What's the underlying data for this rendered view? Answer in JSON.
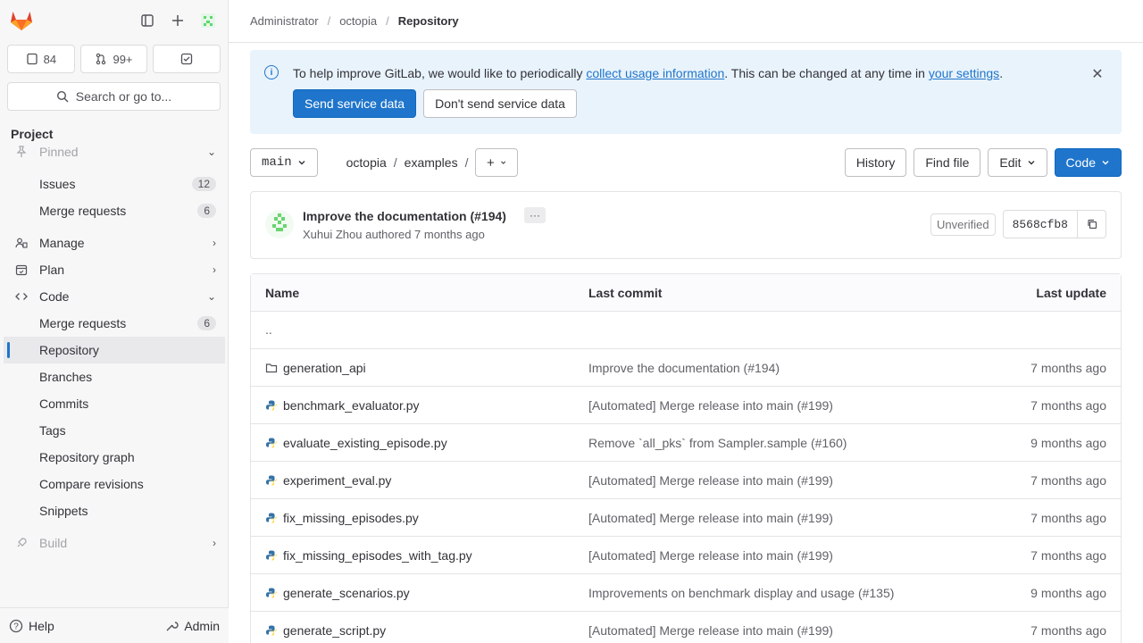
{
  "sidebar": {
    "counts": [
      {
        "icon": "issue-icon",
        "value": "84"
      },
      {
        "icon": "merge-request-icon",
        "value": "99+"
      },
      {
        "icon": "todo-icon",
        "value": ""
      }
    ],
    "search_label": "Search or go to...",
    "section_title": "Project",
    "nav": [
      {
        "label": "Pinned",
        "icon": "pin-icon",
        "badge": "",
        "chevron": "⌄",
        "active": false,
        "faded": true
      },
      {
        "label": "Issues",
        "icon": "",
        "badge": "12",
        "chevron": "",
        "active": false,
        "faded": false
      },
      {
        "label": "Merge requests",
        "icon": "",
        "badge": "6",
        "chevron": "",
        "active": false,
        "faded": false
      },
      {
        "label": "Manage",
        "icon": "users-icon",
        "badge": "",
        "chevron": "›",
        "active": false,
        "faded": false
      },
      {
        "label": "Plan",
        "icon": "calendar-icon",
        "badge": "",
        "chevron": "›",
        "active": false,
        "faded": false
      },
      {
        "label": "Code",
        "icon": "code-icon",
        "badge": "",
        "chevron": "⌄",
        "active": false,
        "faded": false
      },
      {
        "label": "Merge requests",
        "icon": "",
        "badge": "6",
        "chevron": "",
        "active": false,
        "faded": false
      },
      {
        "label": "Repository",
        "icon": "",
        "badge": "",
        "chevron": "",
        "active": true,
        "faded": false
      },
      {
        "label": "Branches",
        "icon": "",
        "badge": "",
        "chevron": "",
        "active": false,
        "faded": false
      },
      {
        "label": "Commits",
        "icon": "",
        "badge": "",
        "chevron": "",
        "active": false,
        "faded": false
      },
      {
        "label": "Tags",
        "icon": "",
        "badge": "",
        "chevron": "",
        "active": false,
        "faded": false
      },
      {
        "label": "Repository graph",
        "icon": "",
        "badge": "",
        "chevron": "",
        "active": false,
        "faded": false
      },
      {
        "label": "Compare revisions",
        "icon": "",
        "badge": "",
        "chevron": "",
        "active": false,
        "faded": false
      },
      {
        "label": "Snippets",
        "icon": "",
        "badge": "",
        "chevron": "",
        "active": false,
        "faded": false
      },
      {
        "label": "Build",
        "icon": "rocket-icon",
        "badge": "",
        "chevron": "›",
        "active": false,
        "faded": true
      }
    ],
    "help_label": "Help",
    "admin_label": "Admin"
  },
  "breadcrumb": [
    "Administrator",
    "octopia",
    "Repository"
  ],
  "alert": {
    "text_before": "To help improve GitLab, we would like to periodically ",
    "link1": "collect usage information",
    "text_middle": ". This can be changed at any time in ",
    "link2": "your settings",
    "text_after": ".",
    "primary_button": "Send service data",
    "secondary_button": "Don't send service data"
  },
  "repo": {
    "branch": "main",
    "path": [
      "octopia",
      "examples"
    ],
    "history": "History",
    "find_file": "Find file",
    "edit": "Edit",
    "code": "Code"
  },
  "commit": {
    "title": "Improve the documentation (#194)",
    "more": "···",
    "author": "Xuhui Zhou authored 7 months ago",
    "status": "Unverified",
    "sha": "8568cfb8"
  },
  "table": {
    "headers": {
      "name": "Name",
      "commit": "Last commit",
      "update": "Last update"
    },
    "parent": "..",
    "rows": [
      {
        "name": "generation_api",
        "type": "folder",
        "commit": "Improve the documentation (#194)",
        "update": "7 months ago"
      },
      {
        "name": "benchmark_evaluator.py",
        "type": "python",
        "commit": "[Automated] Merge release into main (#199)",
        "update": "7 months ago"
      },
      {
        "name": "evaluate_existing_episode.py",
        "type": "python",
        "commit": "Remove `all_pks` from Sampler.sample (#160)",
        "update": "9 months ago"
      },
      {
        "name": "experiment_eval.py",
        "type": "python",
        "commit": "[Automated] Merge release into main (#199)",
        "update": "7 months ago"
      },
      {
        "name": "fix_missing_episodes.py",
        "type": "python",
        "commit": "[Automated] Merge release into main (#199)",
        "update": "7 months ago"
      },
      {
        "name": "fix_missing_episodes_with_tag.py",
        "type": "python",
        "commit": "[Automated] Merge release into main (#199)",
        "update": "7 months ago"
      },
      {
        "name": "generate_scenarios.py",
        "type": "python",
        "commit": "Improvements on benchmark display and usage (#135)",
        "update": "9 months ago"
      },
      {
        "name": "generate_script.py",
        "type": "python",
        "commit": "[Automated] Merge release into main (#199)",
        "update": "7 months ago"
      }
    ]
  },
  "colors": {
    "accent": "#1f75cb",
    "alert_bg": "#e9f3fc",
    "sidebar_bg": "#f7f7f8"
  }
}
